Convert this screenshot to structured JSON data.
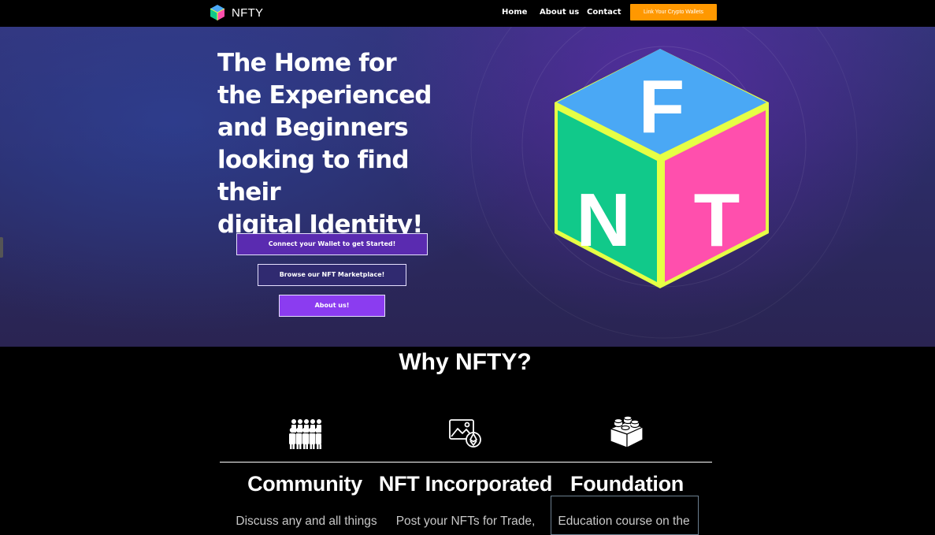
{
  "navbar": {
    "brand": "NFTY",
    "logo_icon": "nft-cube-icon",
    "links": [
      "Home",
      "About us",
      "Contact"
    ],
    "cta": "Link Your Crypto Wallets",
    "cta_color": "#ff9800"
  },
  "hero": {
    "title": "The Home for\nthe Experienced\nand Beginners\nlooking to find their\ndigital Identity!",
    "buttons": {
      "connect": "Connect your Wallet to get Started!",
      "browse": "Browse our NFT Marketplace!",
      "about": "About us!"
    },
    "cube": {
      "letters": [
        "F",
        "N",
        "T"
      ],
      "colors": {
        "top": "#4aa8f5",
        "left": "#11c98a",
        "right": "#ff4fad",
        "edge": "#e6ff45"
      }
    }
  },
  "why": {
    "title": "Why NFTY?",
    "features": [
      {
        "icon": "people-group-icon",
        "title": "Community",
        "text": "Discuss any and all things"
      },
      {
        "icon": "image-ethereum-icon",
        "title": "NFT Incorporated",
        "text": "Post your NFTs for Trade,"
      },
      {
        "icon": "building-block-icon",
        "title": "Foundation",
        "text": "Education course on the"
      }
    ]
  }
}
